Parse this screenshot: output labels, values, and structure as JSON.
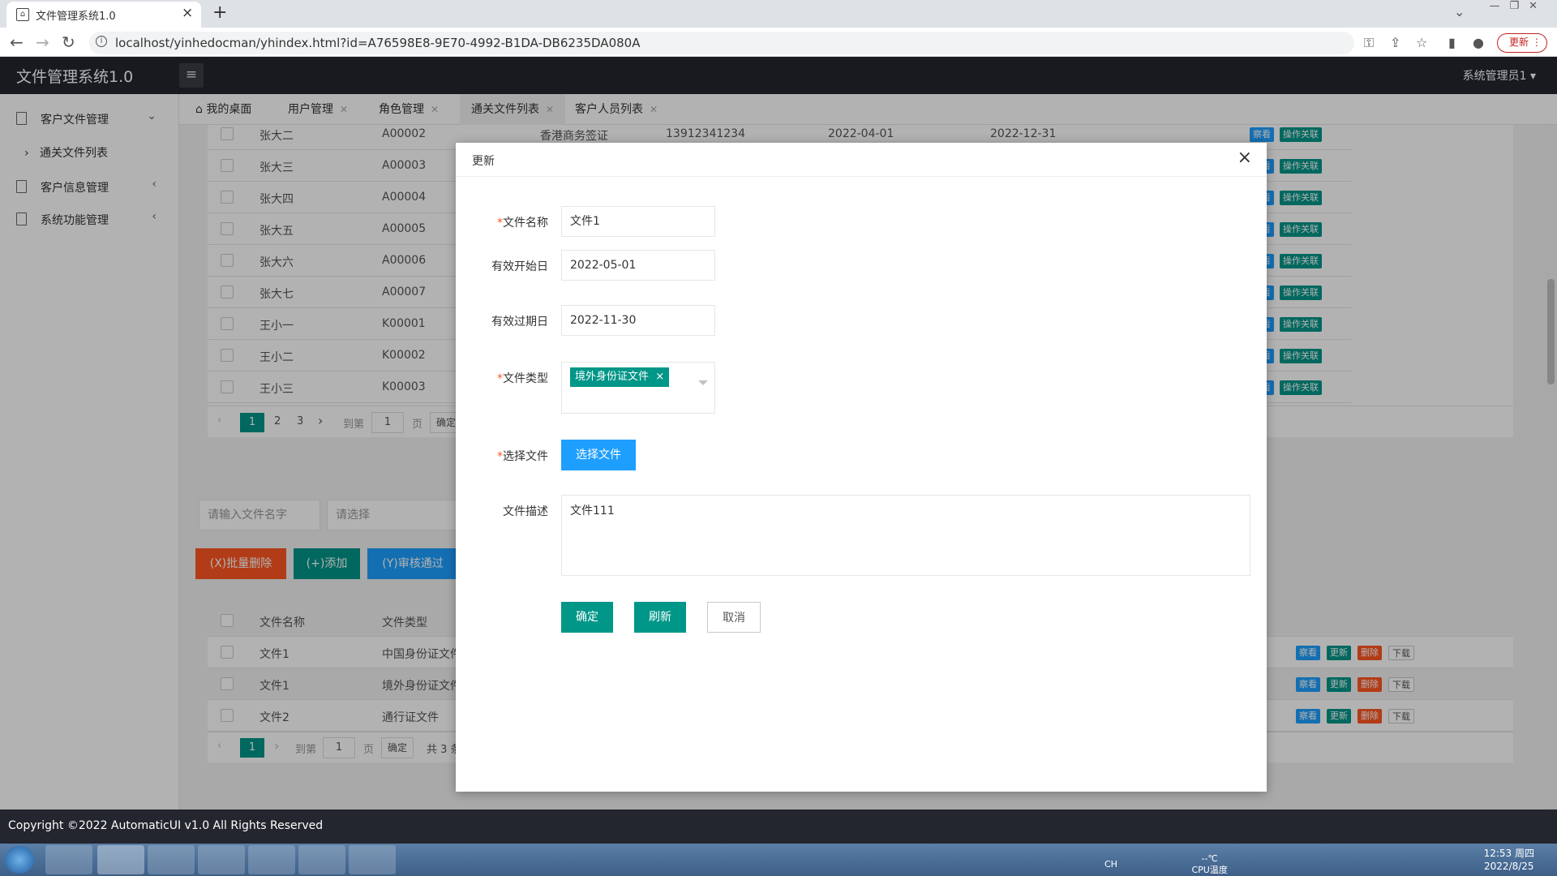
{
  "browser": {
    "tab_title": "文件管理系统1.0",
    "url": "localhost/yinhedocman/yhindex.html?id=A76598E8-9E70-4992-B1DA-DB6235DA080A",
    "update_label": "更新"
  },
  "app": {
    "title": "文件管理系统1.0",
    "user": "系统管理员1"
  },
  "sidebar": {
    "items": [
      {
        "label": "客户文件管理"
      },
      {
        "label": "客户信息管理"
      },
      {
        "label": "系统功能管理"
      }
    ],
    "sub_item": "通关文件列表"
  },
  "page_tabs": [
    {
      "label": "我的桌面"
    },
    {
      "label": "用户管理"
    },
    {
      "label": "角色管理"
    },
    {
      "label": "通关文件列表"
    },
    {
      "label": "客户人员列表"
    }
  ],
  "upper_table": {
    "rows": [
      {
        "name": "张大二",
        "code": "A00002",
        "type": "香港商务签证",
        "phone": "13912341234",
        "start": "2022-04-01",
        "end": "2022-12-31"
      },
      {
        "name": "张大三",
        "code": "A00003"
      },
      {
        "name": "张大四",
        "code": "A00004"
      },
      {
        "name": "张大五",
        "code": "A00005"
      },
      {
        "name": "张大六",
        "code": "A00006"
      },
      {
        "name": "张大七",
        "code": "A00007"
      },
      {
        "name": "王小一",
        "code": "K00001"
      },
      {
        "name": "王小二",
        "code": "K00002"
      },
      {
        "name": "王小三",
        "code": "K00003"
      }
    ],
    "view_label": "察看",
    "link_label": "操作关联",
    "link_label_partial": "关联",
    "pager": {
      "pages": [
        "1",
        "2",
        "3"
      ],
      "goto": "到第",
      "page_input": "1",
      "page_unit": "页",
      "confirm": "确定"
    }
  },
  "search": {
    "name_placeholder": "请输入文件名字",
    "select_placeholder": "请选择"
  },
  "actions": {
    "batch_delete": "(X)批量删除",
    "add": "(+)添加",
    "approve": "(Y)审核通过"
  },
  "lower_table": {
    "headers": [
      "文件名称",
      "文件类型"
    ],
    "rows": [
      {
        "name": "文件1",
        "type": "中国身份证文件"
      },
      {
        "name": "文件1",
        "type": "境外身份证文件"
      },
      {
        "name": "文件2",
        "type": "通行证文件"
      }
    ],
    "row_actions": [
      "察看",
      "更新",
      "删除",
      "下载"
    ],
    "pager": {
      "page": "1",
      "goto": "到第",
      "page_input": "1",
      "page_unit": "页",
      "confirm": "确定",
      "total": "共 3 条"
    }
  },
  "modal": {
    "title": "更新",
    "fields": {
      "file_name_label": "文件名称",
      "file_name_value": "文件1",
      "start_label": "有效开始日",
      "start_value": "2022-05-01",
      "expire_label": "有效过期日",
      "expire_value": "2022-11-30",
      "type_label": "文件类型",
      "type_tag": "境外身份证文件",
      "choose_label": "选择文件",
      "choose_button": "选择文件",
      "desc_label": "文件描述",
      "desc_value": "文件111"
    },
    "buttons": {
      "confirm": "确定",
      "refresh": "刷新",
      "cancel": "取消"
    }
  },
  "footer": {
    "text": "Copyright ©2022 AutomaticUI v1.0 All Rights Reserved"
  },
  "taskbar": {
    "tray_lang": "CH",
    "temp": "--℃",
    "temp_label": "CPU温度",
    "time": "12:53 周四",
    "date": "2022/8/25"
  },
  "colors": {
    "primary": "#009688",
    "blue": "#1e9fff",
    "danger": "#ff5722",
    "header": "#23262e"
  }
}
